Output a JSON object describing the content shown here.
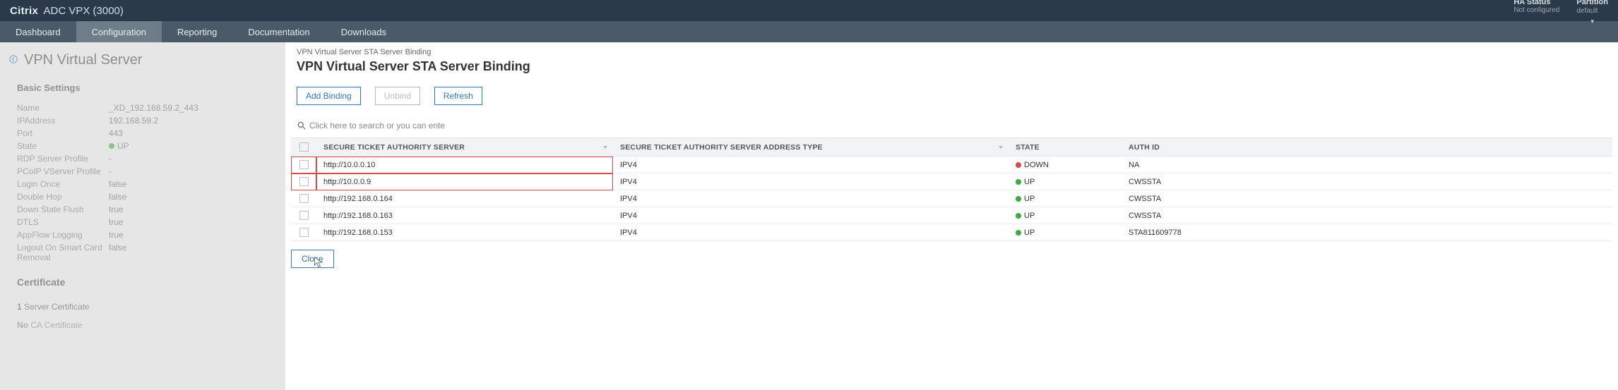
{
  "topbar": {
    "brand_bold": "Citrix",
    "brand_rest": " ADC VPX (3000)",
    "ha_label": "HA Status",
    "ha_value": "Not configured",
    "part_label": "Partition",
    "part_value": "default"
  },
  "nav": {
    "tabs": [
      {
        "label": "Dashboard",
        "active": false
      },
      {
        "label": "Configuration",
        "active": true
      },
      {
        "label": "Reporting",
        "active": false
      },
      {
        "label": "Documentation",
        "active": false
      },
      {
        "label": "Downloads",
        "active": false
      }
    ]
  },
  "left": {
    "title": "VPN Virtual Server",
    "basic_h": "Basic Settings",
    "rows": [
      {
        "k": "Name",
        "v": "_XD_192.168.59.2_443"
      },
      {
        "k": "IPAddress",
        "v": "192.168.59.2"
      },
      {
        "k": "Port",
        "v": "443"
      },
      {
        "k": "State",
        "v": "UP",
        "up": true
      },
      {
        "k": "RDP Server Profile",
        "v": "-"
      },
      {
        "k": "PCoIP VServer Profile",
        "v": "-"
      },
      {
        "k": "Login Once",
        "v": "false"
      },
      {
        "k": "Double Hop",
        "v": "false"
      },
      {
        "k": "Down State Flush",
        "v": "true"
      },
      {
        "k": "DTLS",
        "v": "true"
      },
      {
        "k": "AppFlow Logging",
        "v": "true"
      },
      {
        "k": "Logout On Smart Card Removal",
        "v": "false"
      }
    ],
    "cert_h": "Certificate",
    "cert_server_count": "1",
    "cert_server_label": "Server Certificate",
    "cert_ca_none": "No",
    "cert_ca_label": "CA Certificate"
  },
  "panel": {
    "crumb": "VPN Virtual Server STA Server Binding",
    "title": "VPN Virtual Server STA Server Binding",
    "btn_add": "Add Binding",
    "btn_unbind": "Unbind",
    "btn_refresh": "Refresh",
    "search_placeholder": "Click here to search or you can ente",
    "cols": {
      "server": "Secure Ticket Authority Server",
      "addr": "Secure Ticket Authority Server Address Type",
      "state": "State",
      "auth": "Auth ID"
    },
    "rows": [
      {
        "server": "http://10.0.0.10",
        "addr": "IPV4",
        "state": "DOWN",
        "up": false,
        "auth": "NA",
        "flag": true
      },
      {
        "server": "http://10.0.0.9",
        "addr": "IPV4",
        "state": "UP",
        "up": true,
        "auth": "CWSSTA",
        "flag": true
      },
      {
        "server": "http://192.168.0.164",
        "addr": "IPV4",
        "state": "UP",
        "up": true,
        "auth": "CWSSTA",
        "flag": false
      },
      {
        "server": "http://192.168.0.163",
        "addr": "IPV4",
        "state": "UP",
        "up": true,
        "auth": "CWSSTA",
        "flag": false
      },
      {
        "server": "http://192.168.0.153",
        "addr": "IPV4",
        "state": "UP",
        "up": true,
        "auth": "STA811609778",
        "flag": false
      }
    ],
    "btn_close": "Close"
  }
}
